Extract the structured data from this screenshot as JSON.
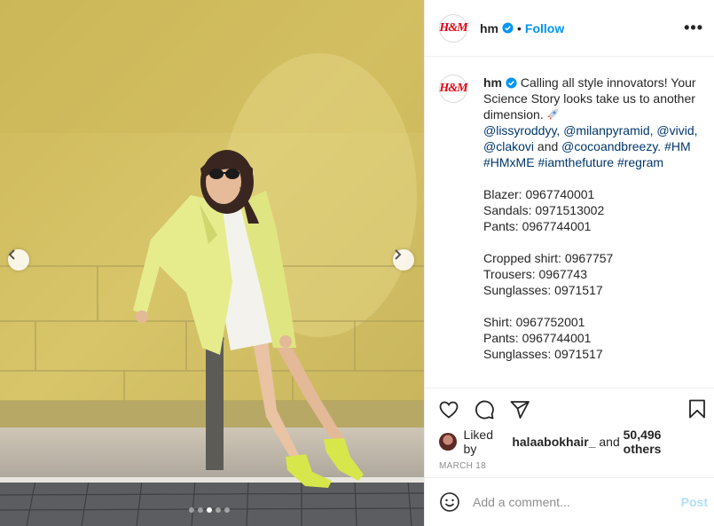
{
  "post": {
    "username": "hm",
    "logo_text": "H&M",
    "follow_label": "Follow",
    "separator": "•",
    "more_icon": "more-horizontal-icon",
    "verified_color": "#0095f6"
  },
  "caption": {
    "username": "hm",
    "intro": "Calling all style innovators! Your Science Story looks take us to another dimension.",
    "mentions": "@lissyroddyy, @milanpyramid, @vivid, @clakovi",
    "and": "and",
    "mention_last": "@cocoandbreezy.",
    "hashtags": "#HM #HMxME #iamthefuture #regram",
    "products": [
      "Blazer: 0967740001",
      "Sandals: 0971513002",
      "Pants: 0967744001",
      "",
      "Cropped shirt: 0967757",
      "Trousers: 0967743",
      "Sunglasses: 0971517",
      "",
      "Shirt: 0967752001",
      "Pants: 0967744001",
      "Sunglasses: 0971517"
    ]
  },
  "likes": {
    "prefix": "Liked by",
    "user": "halaabokhair_",
    "and": "and",
    "count": "50,496 others"
  },
  "date": "MARCH 18",
  "comment": {
    "placeholder": "Add a comment...",
    "post_label": "Post"
  },
  "carousel": {
    "total": 5,
    "active": 3
  },
  "colors": {
    "accent": "#0095f6",
    "brand": "#e50010",
    "hashtag": "#00376b"
  }
}
